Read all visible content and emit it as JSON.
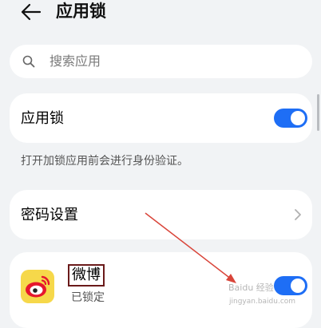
{
  "header": {
    "title": "应用锁",
    "back_icon": "arrow-left-icon"
  },
  "search": {
    "placeholder": "搜索应用",
    "icon": "search-icon"
  },
  "app_lock": {
    "label": "应用锁",
    "enabled": true
  },
  "description": "打开加锁应用前会进行身份验证。",
  "password_settings": {
    "label": "密码设置",
    "icon": "chevron-right-icon"
  },
  "apps": [
    {
      "name": "微博",
      "status": "已锁定",
      "locked": true,
      "icon": "weibo-logo-icon"
    }
  ],
  "watermark": {
    "text": "Baidu 经验",
    "url": "jingyan.baidu.com"
  },
  "colors": {
    "accent": "#1e6ef5",
    "annotation": "#d9453a",
    "background": "#f1f3f5"
  }
}
